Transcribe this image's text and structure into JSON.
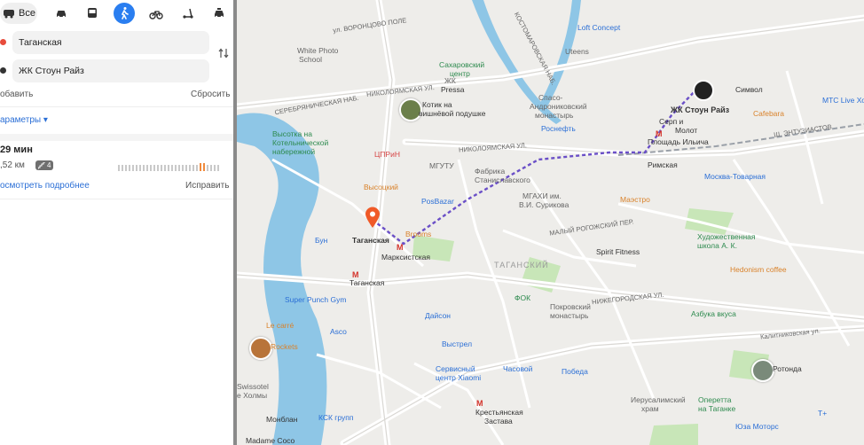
{
  "modes": {
    "all_label": "Все",
    "items": [
      "car-icon",
      "bus-icon",
      "walk-icon",
      "bike-icon",
      "scooter-icon",
      "taxi-icon"
    ],
    "active": "walk-icon"
  },
  "route": {
    "from": "Таганская",
    "to": "ЖК Стоун Райз",
    "add_label": "обавить",
    "reset_label": "Сбросить",
    "params_label": "араметры"
  },
  "result": {
    "time": "29 мин",
    "distance": ",52 км",
    "stairs": "4",
    "details_label": "осмотреть подробнее",
    "fix_label": "Исправить"
  },
  "colors": {
    "accent": "#2a7ef0",
    "route": "#6a4fc7",
    "start_dot": "#e74c3c",
    "end_dot": "#333333",
    "river": "#8ec6e6",
    "park": "#c8e6b8"
  },
  "map": {
    "labels": {
      "vorontsovo": "ул. ВОРОНЦОВО ПОЛЕ",
      "white_photo": "White Photo",
      "white_photo2": "School",
      "loft": "Loft Concept",
      "kostomarov": "КОСТОМАРОВСКАЯ НАБ.",
      "sakharov": "Сахаровский",
      "sakharov2": "центр",
      "uteens": "Uteens",
      "pressa": "Pressa",
      "pressa2": "ЖК",
      "nikol1": "НИКОЛОЯМСКАЯ УЛ.",
      "serebr": "СЕРЕБРЯНИЧЕСКАЯ НАБ.",
      "kotik": "Котик на",
      "kotik2": "вишнёвой подушке",
      "spaso": "Спасо-",
      "spaso2": "Андрониковский",
      "spaso3": "монастырь",
      "simvol": "Символ",
      "mts": "МТС Live Хо",
      "stone": "ЖК Стоун Райз",
      "cafebara": "Cafebara",
      "entuz": "Ш. ЭНТУЗИАСТОВ",
      "rosneft": "Роснефть",
      "serp": "Серп и",
      "serp2": "Молот",
      "ilyicha": "Площадь Ильича",
      "rimskaya": "Римская",
      "kotel": "Высотка на",
      "kotel2": "Котельнической",
      "kotel3": "набережной",
      "tsirk": "ЦПРиН",
      "mgutu": "МГУТУ",
      "fabrika": "Фабрика",
      "fabrika2": "Станиславского",
      "nikol2": "НИКОЛОЯМСКАЯ УЛ.",
      "moskva_tov": "Москва-Товарная",
      "vysotsky": "Высоцкий",
      "posbazar": "PosBazar",
      "mgahi": "МГАХИ им.",
      "mgahi2": "В.И. Сурикова",
      "maestro": "Маэстро",
      "bun": "Бун",
      "taganskaya_pin": "Таганская",
      "brooms": "Brooms",
      "marks": "Марксистская",
      "tagansky": "ТАГАНСКИЙ",
      "rogozh": "МАЛЫЙ РОГОЖСКИЙ ПЕР.",
      "spirit": "Spirit Fitness",
      "hud": "Художественная",
      "hud2": "школа А. К.",
      "hedon": "Hedonism coffee",
      "taganskaya_metro": "Таганская",
      "superpunch": "Super Punch Gym",
      "fok": "ФОК",
      "pokrov": "Покровский",
      "pokrov2": "монастырь",
      "nizhegor": "НИЖЕГОРОДСКАЯ УЛ.",
      "azbuka": "Азбука вкуса",
      "lecarre": "Le carré",
      "daison": "Дайсон",
      "asco": "Asco",
      "rockets": "Rockets",
      "vystrel": "Выстрел",
      "chasovoy": "Часовой",
      "pobeda": "Победа",
      "servis": "Сервисный",
      "servis2": "центр Xiaomi",
      "rotonda": "Ротонда",
      "swissotel": "Swissotel",
      "holmy": "е Холмы",
      "kalit": "Калитниковская ул.",
      "ierusalim": "Иерусалимский",
      "ierusalim2": "храм",
      "operetta": "Оперетта",
      "operetta2": "на Таганке",
      "monblan": "Монблан",
      "ksk": "КСК групп",
      "krest": "Крестьянская",
      "krest2": "Застава",
      "yuza": "Юза Моторс",
      "madame": "Madame Coco",
      "tplus": "Т+"
    }
  }
}
